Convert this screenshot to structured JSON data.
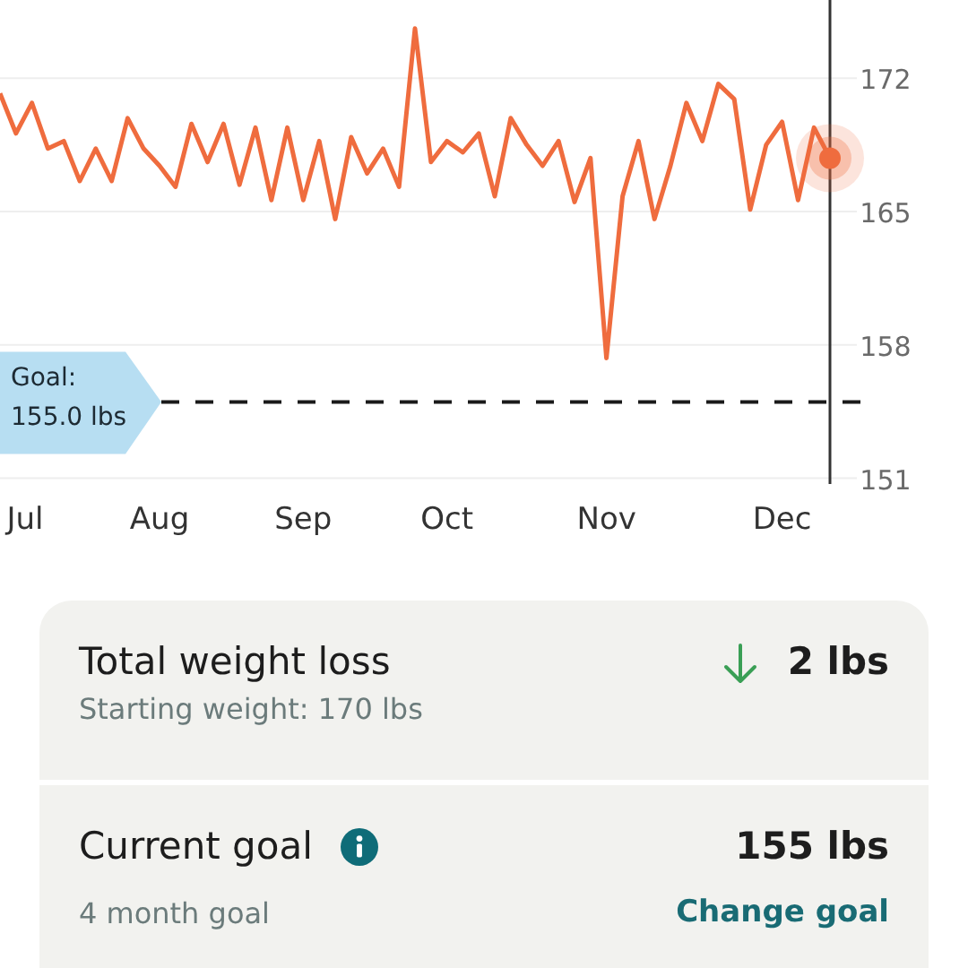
{
  "chart": {
    "chart_data": {
      "type": "line",
      "categories": [
        null,
        "Jul",
        null,
        null,
        null,
        null,
        null,
        null,
        null,
        null,
        "Aug",
        null,
        null,
        null,
        null,
        null,
        null,
        null,
        null,
        "Sep",
        null,
        null,
        null,
        null,
        null,
        null,
        null,
        null,
        "Oct",
        null,
        null,
        null,
        null,
        null,
        null,
        null,
        null,
        null,
        "Nov",
        null,
        null,
        null,
        null,
        null,
        null,
        null,
        null,
        null,
        null,
        "Dec",
        null,
        null,
        null
      ],
      "series": [
        {
          "color": "#ef6c3e",
          "values": [
            171.2,
            169.1,
            170.7,
            168.3,
            168.7,
            166.6,
            168.3,
            166.6,
            169.9,
            168.3,
            167.4,
            166.3,
            169.6,
            167.6,
            169.6,
            166.4,
            169.4,
            165.6,
            169.4,
            165.6,
            168.7,
            164.6,
            168.9,
            167.0,
            168.3,
            166.3,
            174.6,
            167.6,
            168.7,
            168.1,
            169.1,
            165.8,
            169.9,
            168.5,
            167.4,
            168.7,
            165.5,
            167.8,
            157.3,
            165.8,
            168.7,
            164.6,
            167.4,
            170.7,
            168.7,
            171.7,
            170.9,
            165.1,
            168.5,
            169.7,
            165.6,
            169.4,
            167.8
          ]
        }
      ],
      "ylim": [
        150.7,
        176.1
      ],
      "grid": true,
      "yticks": [
        172,
        165,
        158,
        151
      ],
      "ref_lines": [
        {
          "axis": "y",
          "value": 155,
          "label": "Goal: 155.0 lbs"
        }
      ]
    }
  },
  "summary": [
    {
      "title": "Total weight loss",
      "subtitle": "Starting weight: 170 lbs",
      "value": "2 lbs",
      "decrease": true
    },
    {
      "title": "Current goal",
      "info": true,
      "value": "155 lbs",
      "subtitle": "4 month goal",
      "link": "Change goal"
    }
  ]
}
